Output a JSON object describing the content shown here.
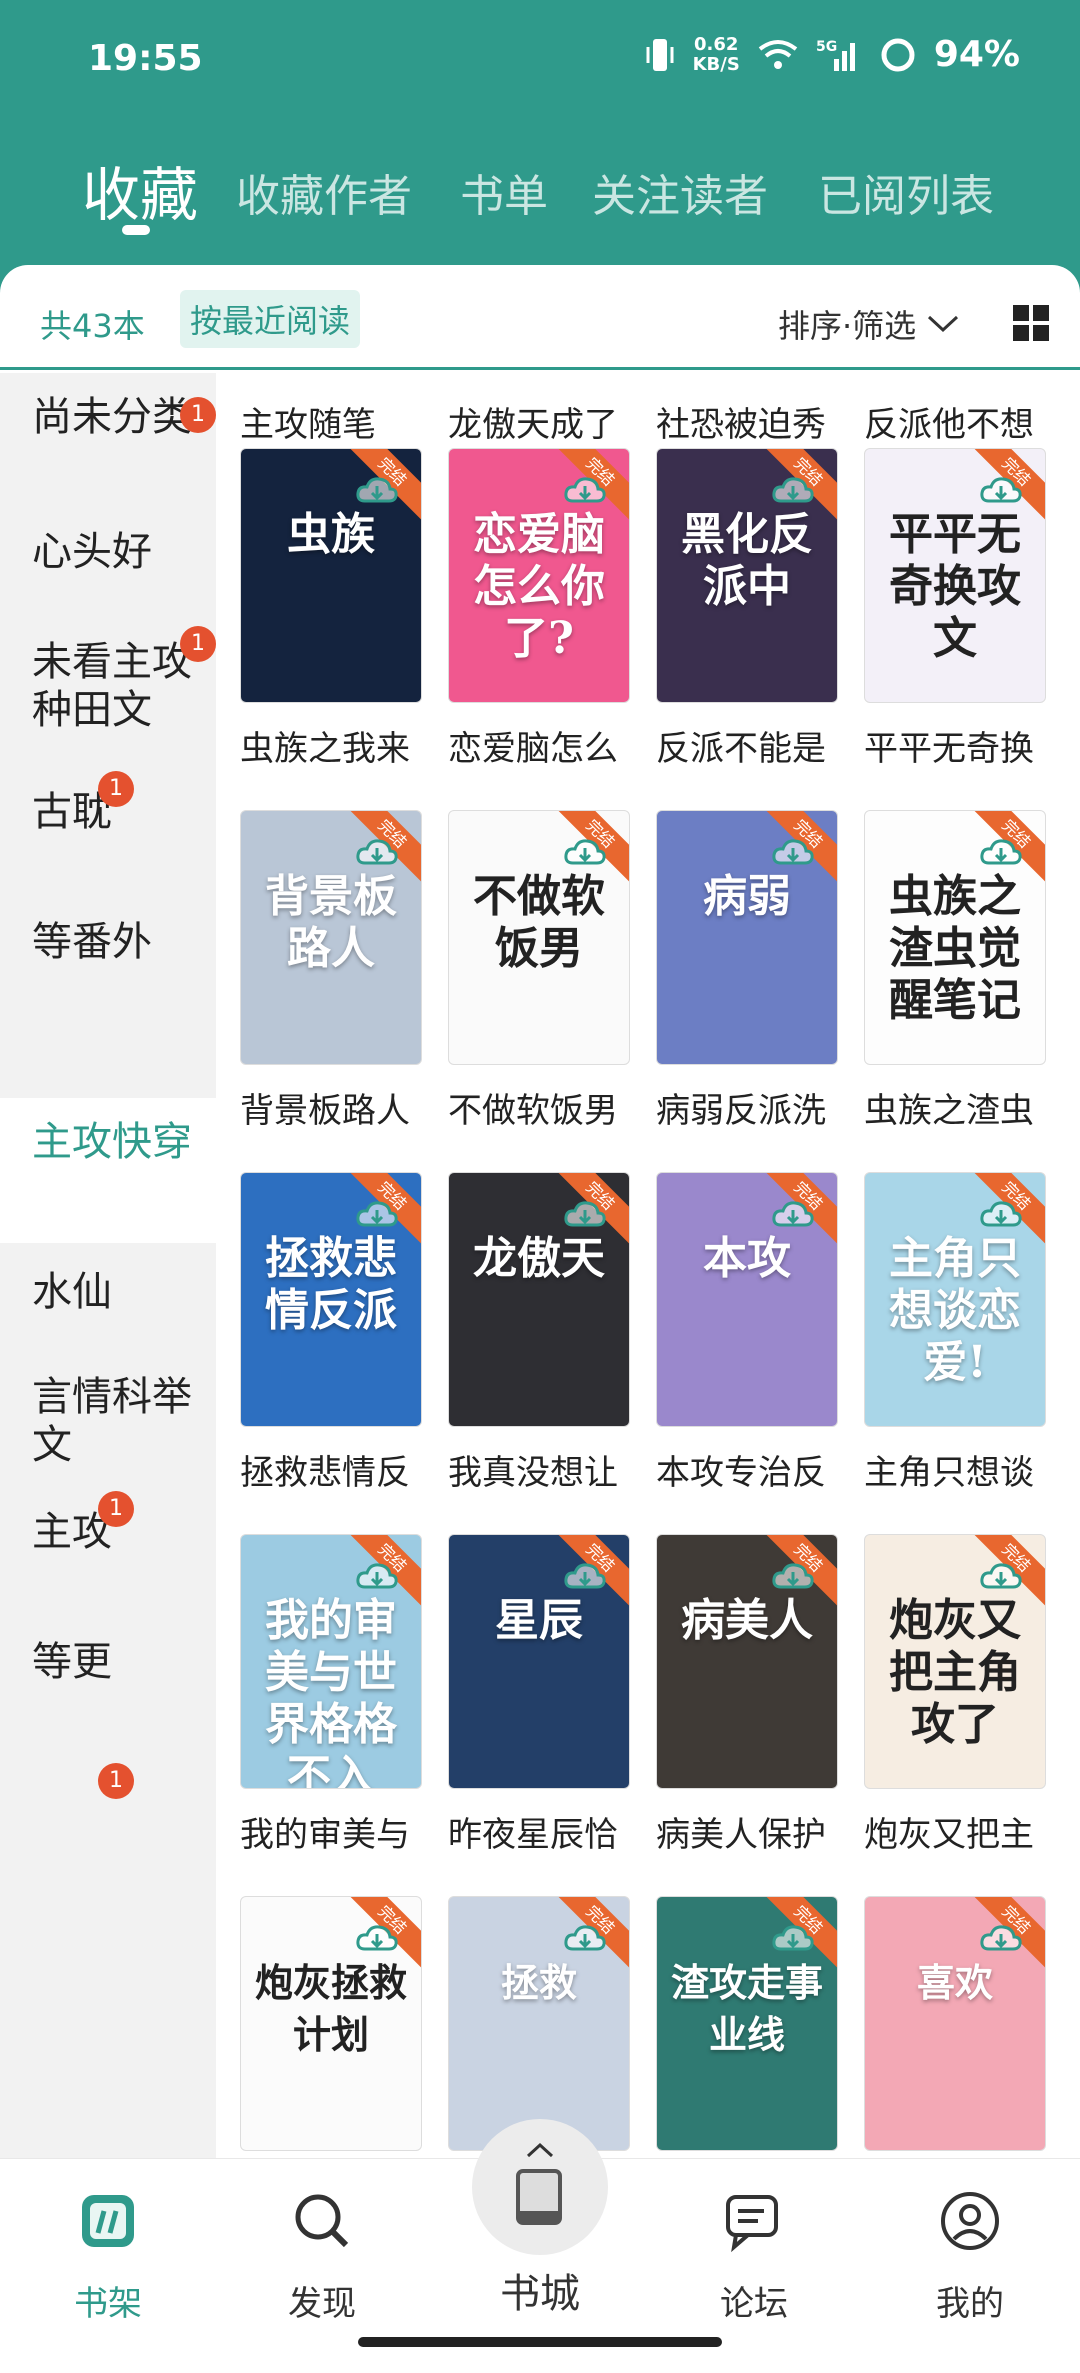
{
  "status": {
    "time": "19:55",
    "speed_value": "0.62",
    "speed_unit": "KB/S",
    "network": "5G",
    "battery": "94%"
  },
  "tabs": [
    {
      "label": "收藏",
      "active": true
    },
    {
      "label": "收藏作者",
      "active": false
    },
    {
      "label": "书单",
      "active": false
    },
    {
      "label": "关注读者",
      "active": false
    },
    {
      "label": "已阅列表",
      "active": false
    }
  ],
  "filter": {
    "count": "共43本",
    "order": "按最近阅读",
    "sort": "排序·筛选"
  },
  "sidebar": {
    "items": [
      {
        "label": "尚未分类",
        "badge": "1"
      },
      {
        "label": "心头好",
        "badge": ""
      },
      {
        "label": "未看主攻种田文",
        "badge": "1"
      },
      {
        "label": "古耽",
        "badge": "1"
      },
      {
        "label": "等番外",
        "badge": ""
      },
      {
        "label": "主攻快穿",
        "badge": "",
        "active": true
      },
      {
        "label": "水仙",
        "badge": ""
      },
      {
        "label": "言情科举文",
        "badge": ""
      },
      {
        "label": "主攻",
        "badge": "1"
      },
      {
        "label": "等更",
        "badge": ""
      },
      {
        "label": "",
        "badge": "1"
      }
    ]
  },
  "books": {
    "partial_row": [
      "主攻随笔",
      "龙傲天成了",
      "社恐被迫秀",
      "反派他不想"
    ],
    "rows": [
      [
        "虫族之我来",
        "恋爱脑怎么",
        "反派不能是",
        "平平无奇换"
      ],
      [
        "背景板路人",
        "不做软饭男",
        "病弱反派洗",
        "虫族之渣虫"
      ],
      [
        "拯救悲情反",
        "我真没想让",
        "本攻专治反",
        "主角只想谈"
      ],
      [
        "我的审美与",
        "昨夜星辰恰",
        "病美人保护",
        "炮灰又把主"
      ],
      [
        "",
        "",
        "",
        ""
      ]
    ],
    "ribbon_text": "完结",
    "cover_titles": [
      [
        "虫族",
        "恋爱脑怎么你了?",
        "黑化反派中",
        "平平无奇换攻文"
      ],
      [
        "背景板路人",
        "不做软饭男",
        "病弱",
        "虫族之渣虫觉醒笔记"
      ],
      [
        "拯救悲情反派",
        "龙傲天",
        "本攻",
        "主角只想谈恋爱!"
      ],
      [
        "我的审美与世界格格不入",
        "星辰",
        "病美人",
        "炮灰又把主角攻了"
      ],
      [
        "炮灰拯救计划",
        "拯救",
        "渣攻走事业线",
        "喜欢"
      ]
    ],
    "cover_colors": [
      [
        "#14233e",
        "#f0588f",
        "#3a2f4e",
        "#f3f0f8"
      ],
      [
        "#b9c6d6",
        "#fafafa",
        "#6c7ec4",
        "#fdfdfd"
      ],
      [
        "#2d6fc0",
        "#2e2e33",
        "#9a88cc",
        "#a9d6e8"
      ],
      [
        "#9ccbe2",
        "#233f68",
        "#3f3a36",
        "#f6ede2"
      ],
      [
        "#fbfbfb",
        "#c9d3e2",
        "#2f7a72",
        "#f3a8b5"
      ]
    ]
  },
  "nav": {
    "items": [
      {
        "label": "书架",
        "icon": "bookshelf-icon",
        "active": true
      },
      {
        "label": "发现",
        "icon": "discover-icon"
      },
      {
        "label": "书城",
        "icon": "book-icon"
      },
      {
        "label": "论坛",
        "icon": "forum-icon"
      },
      {
        "label": "我的",
        "icon": "profile-icon"
      }
    ]
  },
  "colors": {
    "accent": "#2f9a8b",
    "badge": "#e4512f",
    "ribbon": "#e8672f"
  }
}
